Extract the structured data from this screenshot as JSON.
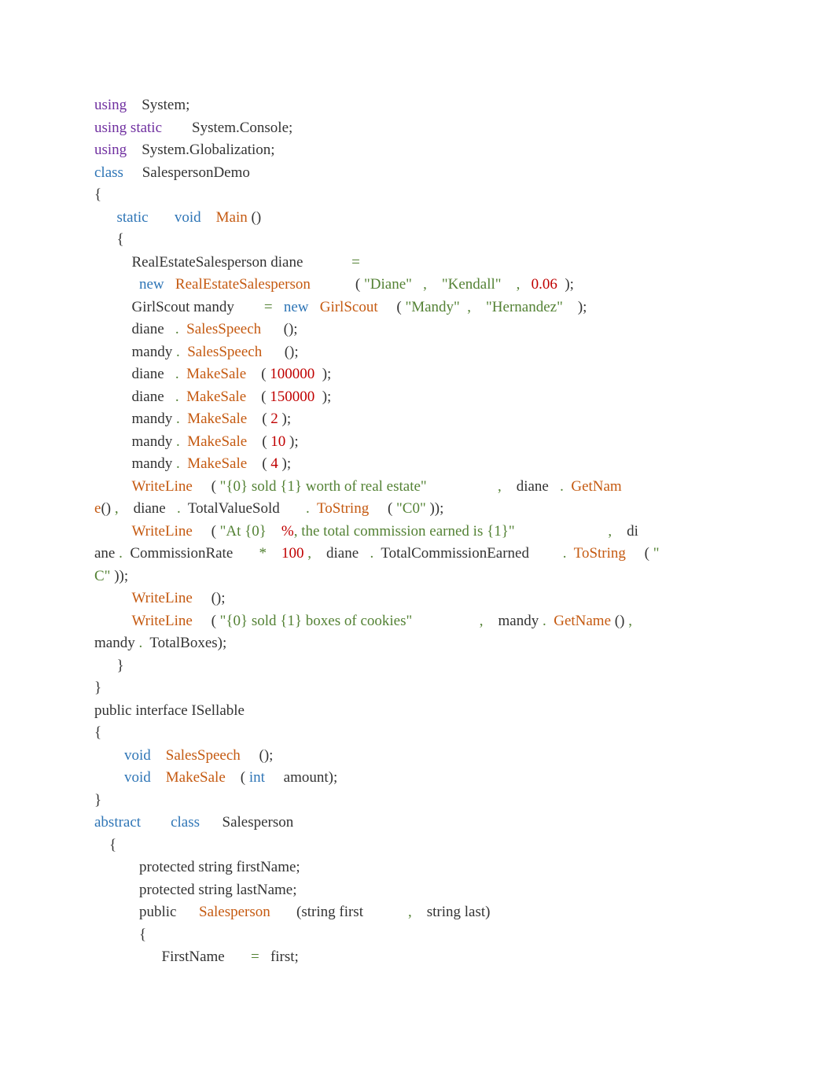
{
  "tokens": [
    {
      "t": "using",
      "c": "c-purple"
    },
    {
      "t": "    System;\n",
      "c": "c-black"
    },
    {
      "t": "using static",
      "c": "c-purple"
    },
    {
      "t": "        System.Console;\n",
      "c": "c-black"
    },
    {
      "t": "using",
      "c": "c-purple"
    },
    {
      "t": "    System.Globalization;\n",
      "c": "c-black"
    },
    {
      "t": "class",
      "c": "c-blue"
    },
    {
      "t": "     SalespersonDemo\n",
      "c": "c-black"
    },
    {
      "t": "{\n",
      "c": "c-black"
    },
    {
      "t": "      ",
      "c": "c-black"
    },
    {
      "t": "static",
      "c": "c-blue"
    },
    {
      "t": "       ",
      "c": "c-black"
    },
    {
      "t": "void",
      "c": "c-blue"
    },
    {
      "t": "    ",
      "c": "c-black"
    },
    {
      "t": "Main",
      "c": "c-orange"
    },
    {
      "t": " ()\n",
      "c": "c-black"
    },
    {
      "t": "      {\n",
      "c": "c-black"
    },
    {
      "t": "          RealEstateSalesperson diane             ",
      "c": "c-black"
    },
    {
      "t": "=",
      "c": "c-green"
    },
    {
      "t": "\n",
      "c": "c-black"
    },
    {
      "t": "            ",
      "c": "c-black"
    },
    {
      "t": "new",
      "c": "c-blue"
    },
    {
      "t": "   ",
      "c": "c-black"
    },
    {
      "t": "RealEstateSalesperson",
      "c": "c-orange"
    },
    {
      "t": "            ( ",
      "c": "c-black"
    },
    {
      "t": "\"Diane\"",
      "c": "c-green"
    },
    {
      "t": "   ",
      "c": "c-black"
    },
    {
      "t": ",",
      "c": "c-green"
    },
    {
      "t": "    ",
      "c": "c-black"
    },
    {
      "t": "\"Kendall\"",
      "c": "c-green"
    },
    {
      "t": "    ",
      "c": "c-black"
    },
    {
      "t": ",",
      "c": "c-green"
    },
    {
      "t": "   ",
      "c": "c-black"
    },
    {
      "t": "0.06",
      "c": "c-red"
    },
    {
      "t": "  );\n",
      "c": "c-black"
    },
    {
      "t": "          GirlScout mandy        ",
      "c": "c-black"
    },
    {
      "t": "=",
      "c": "c-green"
    },
    {
      "t": "   ",
      "c": "c-black"
    },
    {
      "t": "new",
      "c": "c-blue"
    },
    {
      "t": "   ",
      "c": "c-black"
    },
    {
      "t": "GirlScout",
      "c": "c-orange"
    },
    {
      "t": "     ( ",
      "c": "c-black"
    },
    {
      "t": "\"Mandy\"",
      "c": "c-green"
    },
    {
      "t": "  ",
      "c": "c-black"
    },
    {
      "t": ",",
      "c": "c-green"
    },
    {
      "t": "    ",
      "c": "c-black"
    },
    {
      "t": "\"Hernandez\"",
      "c": "c-green"
    },
    {
      "t": "    );\n",
      "c": "c-black"
    },
    {
      "t": "          diane   ",
      "c": "c-black"
    },
    {
      "t": ".",
      "c": "c-green"
    },
    {
      "t": "  ",
      "c": "c-black"
    },
    {
      "t": "SalesSpeech",
      "c": "c-orange"
    },
    {
      "t": "      ();\n",
      "c": "c-black"
    },
    {
      "t": "          mandy ",
      "c": "c-black"
    },
    {
      "t": ".",
      "c": "c-green"
    },
    {
      "t": "  ",
      "c": "c-black"
    },
    {
      "t": "SalesSpeech",
      "c": "c-orange"
    },
    {
      "t": "      ();\n",
      "c": "c-black"
    },
    {
      "t": "          diane   ",
      "c": "c-black"
    },
    {
      "t": ".",
      "c": "c-green"
    },
    {
      "t": "  ",
      "c": "c-black"
    },
    {
      "t": "MakeSale",
      "c": "c-orange"
    },
    {
      "t": "    ( ",
      "c": "c-black"
    },
    {
      "t": "100000",
      "c": "c-red"
    },
    {
      "t": "  );\n",
      "c": "c-black"
    },
    {
      "t": "          diane   ",
      "c": "c-black"
    },
    {
      "t": ".",
      "c": "c-green"
    },
    {
      "t": "  ",
      "c": "c-black"
    },
    {
      "t": "MakeSale",
      "c": "c-orange"
    },
    {
      "t": "    ( ",
      "c": "c-black"
    },
    {
      "t": "150000",
      "c": "c-red"
    },
    {
      "t": "  );\n",
      "c": "c-black"
    },
    {
      "t": "          mandy ",
      "c": "c-black"
    },
    {
      "t": ".",
      "c": "c-green"
    },
    {
      "t": "  ",
      "c": "c-black"
    },
    {
      "t": "MakeSale",
      "c": "c-orange"
    },
    {
      "t": "    ( ",
      "c": "c-black"
    },
    {
      "t": "2",
      "c": "c-red"
    },
    {
      "t": " );\n",
      "c": "c-black"
    },
    {
      "t": "          mandy ",
      "c": "c-black"
    },
    {
      "t": ".",
      "c": "c-green"
    },
    {
      "t": "  ",
      "c": "c-black"
    },
    {
      "t": "MakeSale",
      "c": "c-orange"
    },
    {
      "t": "    ( ",
      "c": "c-black"
    },
    {
      "t": "10",
      "c": "c-red"
    },
    {
      "t": " );\n",
      "c": "c-black"
    },
    {
      "t": "          mandy ",
      "c": "c-black"
    },
    {
      "t": ".",
      "c": "c-green"
    },
    {
      "t": "  ",
      "c": "c-black"
    },
    {
      "t": "MakeSale",
      "c": "c-orange"
    },
    {
      "t": "    ( ",
      "c": "c-black"
    },
    {
      "t": "4",
      "c": "c-red"
    },
    {
      "t": " );\n",
      "c": "c-black"
    },
    {
      "t": "          ",
      "c": "c-black"
    },
    {
      "t": "WriteLine",
      "c": "c-orange"
    },
    {
      "t": "     ( ",
      "c": "c-black"
    },
    {
      "t": "\"{0} sold {1} worth of real estate\"",
      "c": "c-green"
    },
    {
      "t": "                   ",
      "c": "c-black"
    },
    {
      "t": ",",
      "c": "c-green"
    },
    {
      "t": "    diane   ",
      "c": "c-black"
    },
    {
      "t": ".",
      "c": "c-green"
    },
    {
      "t": "  ",
      "c": "c-black"
    },
    {
      "t": "GetNam\ne",
      "c": "c-orange"
    },
    {
      "t": "() ",
      "c": "c-black"
    },
    {
      "t": ",",
      "c": "c-green"
    },
    {
      "t": "    diane   ",
      "c": "c-black"
    },
    {
      "t": ".",
      "c": "c-green"
    },
    {
      "t": "  TotalValueSold       ",
      "c": "c-black"
    },
    {
      "t": ".",
      "c": "c-green"
    },
    {
      "t": "  ",
      "c": "c-black"
    },
    {
      "t": "ToString",
      "c": "c-orange"
    },
    {
      "t": "     ( ",
      "c": "c-black"
    },
    {
      "t": "\"C0\"",
      "c": "c-green"
    },
    {
      "t": " ));\n",
      "c": "c-black"
    },
    {
      "t": "          ",
      "c": "c-black"
    },
    {
      "t": "WriteLine",
      "c": "c-orange"
    },
    {
      "t": "     ( ",
      "c": "c-black"
    },
    {
      "t": "\"At {0}",
      "c": "c-green"
    },
    {
      "t": "    ",
      "c": "c-black"
    },
    {
      "t": "%",
      "c": "c-red"
    },
    {
      "t": ", the total commission earned is {1}\"",
      "c": "c-green"
    },
    {
      "t": "                         ",
      "c": "c-black"
    },
    {
      "t": ",",
      "c": "c-green"
    },
    {
      "t": "    di\nane ",
      "c": "c-black"
    },
    {
      "t": ".",
      "c": "c-green"
    },
    {
      "t": "  CommissionRate       ",
      "c": "c-black"
    },
    {
      "t": "*",
      "c": "c-green"
    },
    {
      "t": "    ",
      "c": "c-black"
    },
    {
      "t": "100",
      "c": "c-red"
    },
    {
      "t": " ",
      "c": "c-black"
    },
    {
      "t": ",",
      "c": "c-green"
    },
    {
      "t": "    diane   ",
      "c": "c-black"
    },
    {
      "t": ".",
      "c": "c-green"
    },
    {
      "t": "  TotalCommissionEarned         ",
      "c": "c-black"
    },
    {
      "t": ".",
      "c": "c-green"
    },
    {
      "t": "  ",
      "c": "c-black"
    },
    {
      "t": "ToString",
      "c": "c-orange"
    },
    {
      "t": "     ( ",
      "c": "c-black"
    },
    {
      "t": "\"\nC\"",
      "c": "c-green"
    },
    {
      "t": " ));\n",
      "c": "c-black"
    },
    {
      "t": "          ",
      "c": "c-black"
    },
    {
      "t": "WriteLine",
      "c": "c-orange"
    },
    {
      "t": "     ();\n",
      "c": "c-black"
    },
    {
      "t": "          ",
      "c": "c-black"
    },
    {
      "t": "WriteLine",
      "c": "c-orange"
    },
    {
      "t": "     ( ",
      "c": "c-black"
    },
    {
      "t": "\"{0} sold {1} boxes of cookies\"",
      "c": "c-green"
    },
    {
      "t": "                  ",
      "c": "c-black"
    },
    {
      "t": ",",
      "c": "c-green"
    },
    {
      "t": "    mandy ",
      "c": "c-black"
    },
    {
      "t": ".",
      "c": "c-green"
    },
    {
      "t": "  ",
      "c": "c-black"
    },
    {
      "t": "GetName",
      "c": "c-orange"
    },
    {
      "t": " () ",
      "c": "c-black"
    },
    {
      "t": ",",
      "c": "c-green"
    },
    {
      "t": "    \nmandy ",
      "c": "c-black"
    },
    {
      "t": ".",
      "c": "c-green"
    },
    {
      "t": "  TotalBoxes);\n",
      "c": "c-black"
    },
    {
      "t": "      }\n",
      "c": "c-black"
    },
    {
      "t": "}\n",
      "c": "c-black"
    },
    {
      "t": "public interface ISellable\n",
      "c": "c-black"
    },
    {
      "t": "{\n",
      "c": "c-black"
    },
    {
      "t": "        ",
      "c": "c-black"
    },
    {
      "t": "void",
      "c": "c-blue"
    },
    {
      "t": "    ",
      "c": "c-black"
    },
    {
      "t": "SalesSpeech",
      "c": "c-orange"
    },
    {
      "t": "     ();\n",
      "c": "c-black"
    },
    {
      "t": "        ",
      "c": "c-black"
    },
    {
      "t": "void",
      "c": "c-blue"
    },
    {
      "t": "    ",
      "c": "c-black"
    },
    {
      "t": "MakeSale",
      "c": "c-orange"
    },
    {
      "t": "    ( ",
      "c": "c-black"
    },
    {
      "t": "int",
      "c": "c-blue"
    },
    {
      "t": "     amount);\n",
      "c": "c-black"
    },
    {
      "t": "}\n",
      "c": "c-black"
    },
    {
      "t": "abstract",
      "c": "c-blue"
    },
    {
      "t": "        ",
      "c": "c-black"
    },
    {
      "t": "class",
      "c": "c-blue"
    },
    {
      "t": "      Salesperson\n",
      "c": "c-black"
    },
    {
      "t": "    {\n",
      "c": "c-black"
    },
    {
      "t": "            protected string firstName;\n",
      "c": "c-black"
    },
    {
      "t": "            protected string lastName;\n",
      "c": "c-black"
    },
    {
      "t": "            public      ",
      "c": "c-black"
    },
    {
      "t": "Salesperson",
      "c": "c-orange"
    },
    {
      "t": "       (string first            ",
      "c": "c-black"
    },
    {
      "t": ",",
      "c": "c-green"
    },
    {
      "t": "    string last)\n",
      "c": "c-black"
    },
    {
      "t": "            {\n",
      "c": "c-black"
    },
    {
      "t": "                  FirstName       ",
      "c": "c-black"
    },
    {
      "t": "=",
      "c": "c-green"
    },
    {
      "t": "   first;",
      "c": "c-black"
    }
  ]
}
